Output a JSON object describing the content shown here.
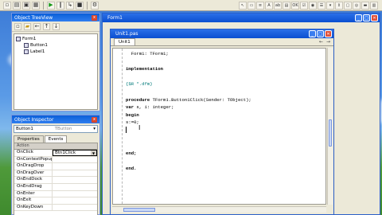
{
  "toolbar": {
    "icons": [
      "new-icon",
      "open-icon",
      "save-icon",
      "save-all-icon",
      "run-icon",
      "pause-icon",
      "step-icon",
      "stop-icon",
      "build-icon"
    ]
  },
  "treeview": {
    "title": "Object TreeView",
    "close": "x",
    "nodes": [
      {
        "label": "Form1",
        "level": 0
      },
      {
        "label": "Button1",
        "level": 1
      },
      {
        "label": "Label1",
        "level": 1
      }
    ]
  },
  "inspector": {
    "title": "Object Inspector",
    "close": "x",
    "component": "Button1",
    "component_type": "TButton",
    "tabs": [
      {
        "label": "Properties",
        "active": false
      },
      {
        "label": "Events",
        "active": true
      }
    ],
    "column_header": "Action",
    "rows": [
      {
        "key": "OnClick",
        "value": "Btn1Click",
        "selected": true
      },
      {
        "key": "OnContextPopup",
        "value": ""
      },
      {
        "key": "OnDragDrop",
        "value": ""
      },
      {
        "key": "OnDragOver",
        "value": ""
      },
      {
        "key": "OnEndDock",
        "value": ""
      },
      {
        "key": "OnEndDrag",
        "value": ""
      },
      {
        "key": "OnEnter",
        "value": ""
      },
      {
        "key": "OnExit",
        "value": ""
      },
      {
        "key": "OnKeyDown",
        "value": ""
      }
    ]
  },
  "form1": {
    "title": "Form1"
  },
  "editor": {
    "title": "Unit1.pas",
    "tab": "Unit1",
    "nav_back": "←",
    "nav_fwd": "→",
    "lines": [
      {
        "text": "  Form1: TForm1;",
        "style": ""
      },
      {
        "text": "",
        "style": ""
      },
      {
        "text": "implementation",
        "style": "kw"
      },
      {
        "text": "",
        "style": ""
      },
      {
        "text": "{$R *.dfm}",
        "style": "cm"
      },
      {
        "text": "",
        "style": ""
      },
      {
        "text": "procedure TForm1.Button1Click(Sender: TObject);",
        "style": "proc"
      },
      {
        "text": "var s, i: integer;",
        "style": "var"
      },
      {
        "text": "begin",
        "style": "kw"
      },
      {
        "text": "s:=0;",
        "style": ""
      },
      {
        "text": "",
        "style": "caret"
      },
      {
        "text": "",
        "style": ""
      },
      {
        "text": "",
        "style": ""
      },
      {
        "text": "end;",
        "style": "kw"
      },
      {
        "text": "",
        "style": ""
      },
      {
        "text": "end.",
        "style": "kw"
      }
    ]
  },
  "colors": {
    "title_bar": "#0b4fd0",
    "desktop_sky": "#3a79d6",
    "comment": "#007a7a"
  }
}
